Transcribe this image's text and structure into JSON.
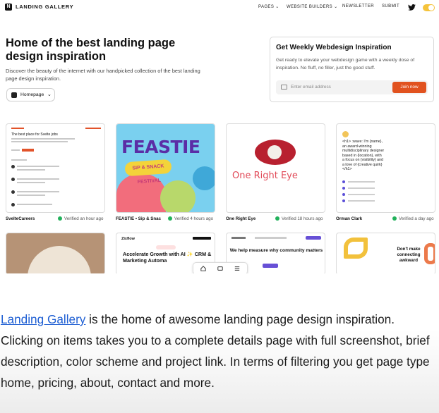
{
  "nav": {
    "brand": "LANDING GALLERY",
    "pages_label": "PAGES",
    "website_builders_label": "WEBSITE BUILDERS",
    "newsletter_label": "NEWSLETTER",
    "submit_label": "SUBMIT",
    "twitter_icon": "twitter-icon",
    "theme_toggle_color": "#f5c33b"
  },
  "hero": {
    "title": "Home of the best landing page design inspiration",
    "subtitle": "Discover the beauty of the internet with our handpicked collection of the best landing page design inspiration.",
    "page_type_selected": "Homepage"
  },
  "newsletter": {
    "title": "Get Weekly Webdesign Inspiration",
    "description": "Get ready to elevate your webdesign game with a weekly dose of inspiration. No fluff, no filler, just the good stuff.",
    "email_placeholder": "Enter email address",
    "button_label": "Join now",
    "button_color": "#e1521f"
  },
  "cards": [
    {
      "name": "SvelteCareers",
      "verified": "Verified an hour ago",
      "preview_heading": "The best place for Svelte jobs"
    },
    {
      "name": "FEASTIE • Sip & Snac",
      "verified": "Verified 4 hours ago",
      "preview_heading": "FEASTIE",
      "preview_badge": "SIP & SNACK FESTIVAL"
    },
    {
      "name": "One Right Eye",
      "verified": "Verified 18 hours ago",
      "preview_heading": "One Right Eye"
    },
    {
      "name": "Orman Clark",
      "verified": "Verified a day ago",
      "preview_heading": "<h1> :wave: I'm {name}, an award-winning multidisciplinary designer based in {location}, with a focus on {visibility} and a love of {creative quirk}</h1>"
    }
  ],
  "cards_row2": [
    {
      "preview_heading": ""
    },
    {
      "brand": "Zixflow",
      "preview_heading": "Accelerate Growth with AI ✨ CRM & Marketing Automa"
    },
    {
      "preview_heading": "We help measure why community matters"
    },
    {
      "preview_heading": "Don't make connecting awkward"
    }
  ],
  "verified_color": "#22b15b",
  "description": {
    "link_text": "Landing Gallery",
    "text": " is the home of awesome landing page design inspiration. Clicking on items takes you to a complete details page with full screenshot, brief description, color scheme and project link. In terms of filtering you get page type home, pricing, about, contact and more.",
    "link_color": "#1f5fd3"
  }
}
